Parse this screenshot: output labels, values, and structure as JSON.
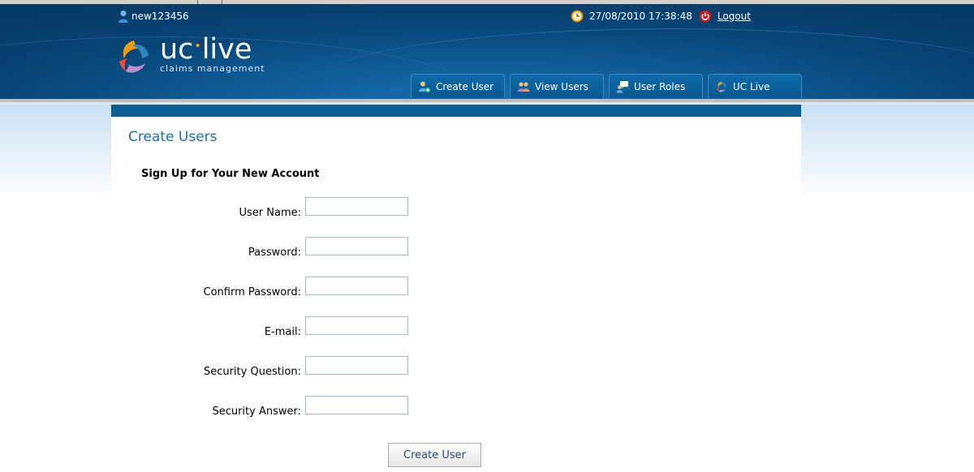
{
  "header": {
    "username": "new123456",
    "datetime": "27/08/2010 17:38:48",
    "logout_label": "Logout"
  },
  "logo": {
    "brand_left": "uc",
    "brand_dot": "•",
    "brand_right": "live",
    "subtitle": "claims management"
  },
  "nav": {
    "tabs": [
      {
        "label": "Create User",
        "icon": "create-user-icon"
      },
      {
        "label": "View Users",
        "icon": "view-users-icon"
      },
      {
        "label": "User Roles",
        "icon": "user-roles-icon"
      },
      {
        "label": "UC Live",
        "icon": "uc-live-icon"
      }
    ]
  },
  "page": {
    "title": "Create Users",
    "heading": "Sign Up for Your New Account"
  },
  "form": {
    "fields": [
      {
        "label": "User Name:",
        "value": ""
      },
      {
        "label": "Password:",
        "value": ""
      },
      {
        "label": "Confirm Password:",
        "value": ""
      },
      {
        "label": "E-mail:",
        "value": ""
      },
      {
        "label": "Security Question:",
        "value": ""
      },
      {
        "label": "Security Answer:",
        "value": ""
      }
    ],
    "submit_label": "Create User"
  },
  "colors": {
    "header_blue": "#094f85",
    "content_bar": "#0a5e92",
    "title_blue": "#1e6fa3",
    "logo_accent": "#f5a623"
  }
}
